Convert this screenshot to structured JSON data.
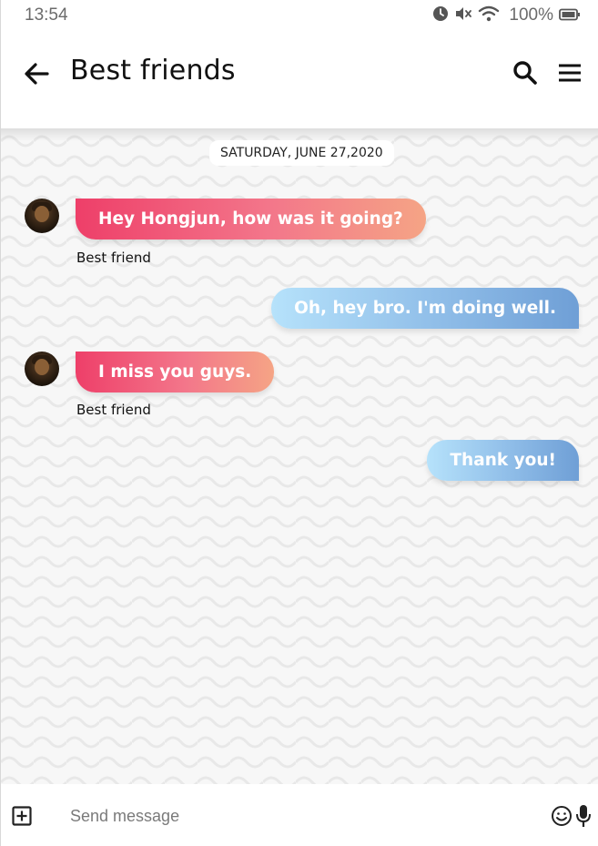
{
  "status_bar": {
    "time": "13:54",
    "battery_percent": "100%",
    "icons": [
      "alarm-icon",
      "mute-icon",
      "wifi-icon",
      "battery-icon"
    ]
  },
  "header": {
    "title": "Best friends",
    "icons": [
      "back-arrow-icon",
      "search-icon",
      "menu-icon"
    ]
  },
  "chat": {
    "date_label": "SATURDAY, JUNE 27,2020",
    "messages": [
      {
        "direction": "incoming",
        "text": "Hey Hongjun, how was it going?",
        "sender": "Best friend"
      },
      {
        "direction": "outgoing",
        "text": "Oh, hey bro. I'm doing well."
      },
      {
        "direction": "incoming",
        "text": "I miss you guys.",
        "sender": "Best friend"
      },
      {
        "direction": "outgoing",
        "text": "Thank you!"
      }
    ]
  },
  "input_bar": {
    "placeholder": "Send message",
    "icons": [
      "add-attachment-icon",
      "emoji-icon",
      "microphone-icon"
    ]
  },
  "colors": {
    "incoming_gradient": [
      "#ee3f69",
      "#f5a485"
    ],
    "outgoing_gradient": [
      "#b6e2fb",
      "#6f9fd6"
    ],
    "chat_background": "#f7f7f7"
  }
}
